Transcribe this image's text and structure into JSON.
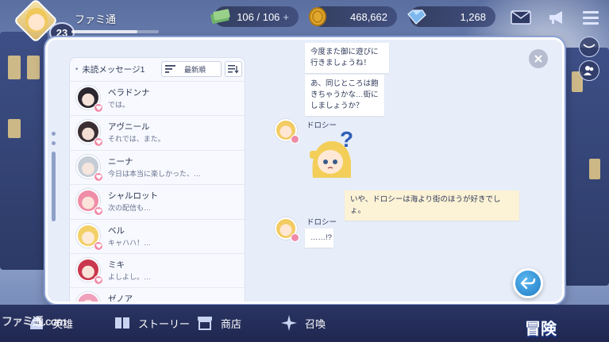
{
  "player": {
    "name": "ファミ通",
    "level": "23",
    "xp_fraction": 0.75
  },
  "resources": {
    "stamina": "106 / 106",
    "stamina_plus": "+",
    "gold": "468,662",
    "gems": "1,268"
  },
  "inbox": {
    "unread_label": "未読メッセージ1",
    "sort_label": "最新順",
    "contacts": [
      {
        "name": "ベラドンナ",
        "preview": "では。"
      },
      {
        "name": "アヴニール",
        "preview": "それでは、また。"
      },
      {
        "name": "ニーナ",
        "preview": "今日は本当に楽しかった、…"
      },
      {
        "name": "シャルロット",
        "preview": "次の配信も…"
      },
      {
        "name": "ベル",
        "preview": "キャハハ！…"
      },
      {
        "name": "ミキ",
        "preview": "よしよし。…"
      },
      {
        "name": "ゼノア",
        "preview": ""
      }
    ]
  },
  "chat": {
    "messages": [
      {
        "from": "other",
        "text": "今度また御に遊びに行きましょうね！"
      },
      {
        "from": "other",
        "text": "あ、同じところは飽きちゃうかな…街にしましょうか？"
      },
      {
        "from": "other",
        "speaker": "ドロシー",
        "sticker": "?"
      },
      {
        "from": "me",
        "text": "いや、ドロシーは海より街のほうが好きでしょ。"
      },
      {
        "from": "other",
        "speaker": "ドロシー",
        "text": "……!?"
      }
    ]
  },
  "bottom_nav": {
    "items": [
      "英雄",
      "ストーリー",
      "商店",
      "召喚"
    ],
    "adventure": "冒険",
    "watermark": "ファミ通.com"
  },
  "colors": {
    "accent": "#1f7cc7",
    "dialog_bg": "#e7eefa",
    "nav_bg": "#2b3563",
    "my_bubble": "#fcf2d5"
  }
}
